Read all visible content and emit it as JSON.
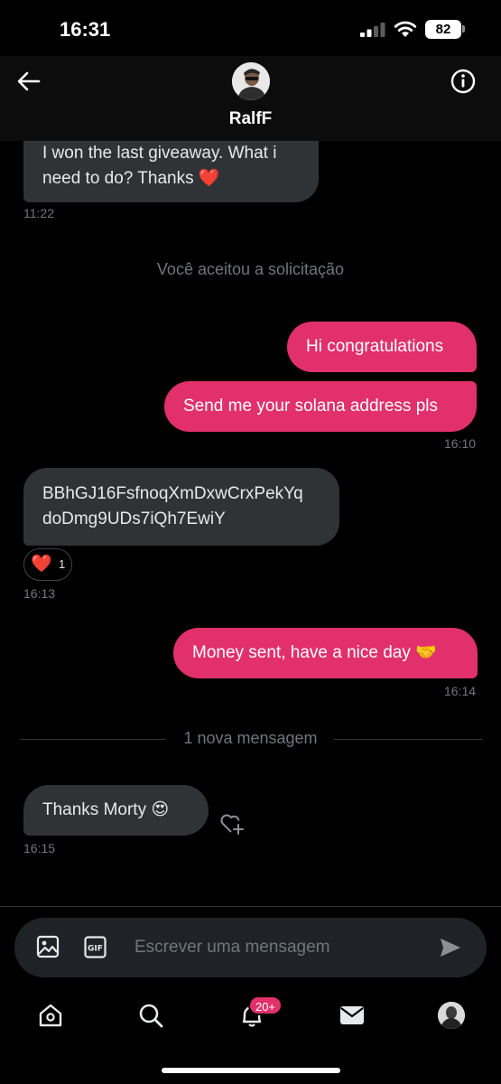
{
  "status": {
    "time": "16:31",
    "battery": "82"
  },
  "header": {
    "contact_name": "RalfF"
  },
  "messages": {
    "m1_line1": "I won the last giveaway. What i",
    "m1_line2": "need to do? Thanks ❤️",
    "m1_time": "11:22",
    "system_accepted": "Você aceitou a solicitação",
    "m2": "Hi congratulations",
    "m3": "Send me your solana address pls",
    "m3_time": "16:10",
    "m4_line1": "BBhGJ16FsfnoqXmDxwCrxPekYq",
    "m4_line2": "doDmg9UDs7iQh7EwiY",
    "m4_reaction": "❤️",
    "m4_reaction_count": "1",
    "m4_time": "16:13",
    "m5": "Money sent, have a nice day 🤝",
    "m5_time": "16:14",
    "new_divider": "1 nova mensagem",
    "m6": "Thanks Morty 😍",
    "m6_time": "16:15"
  },
  "composer": {
    "placeholder": "Escrever uma mensagem"
  },
  "tabbar": {
    "notifications_badge": "20+"
  },
  "colors": {
    "accent": "#e1306c",
    "incoming_bubble": "#2f3336",
    "muted_text": "#71767b",
    "background": "#000000"
  },
  "icons": [
    "back-arrow-icon",
    "info-icon",
    "image-icon",
    "gif-icon",
    "send-icon",
    "home-icon",
    "search-icon",
    "bell-icon",
    "mail-icon",
    "add-reaction-icon"
  ]
}
